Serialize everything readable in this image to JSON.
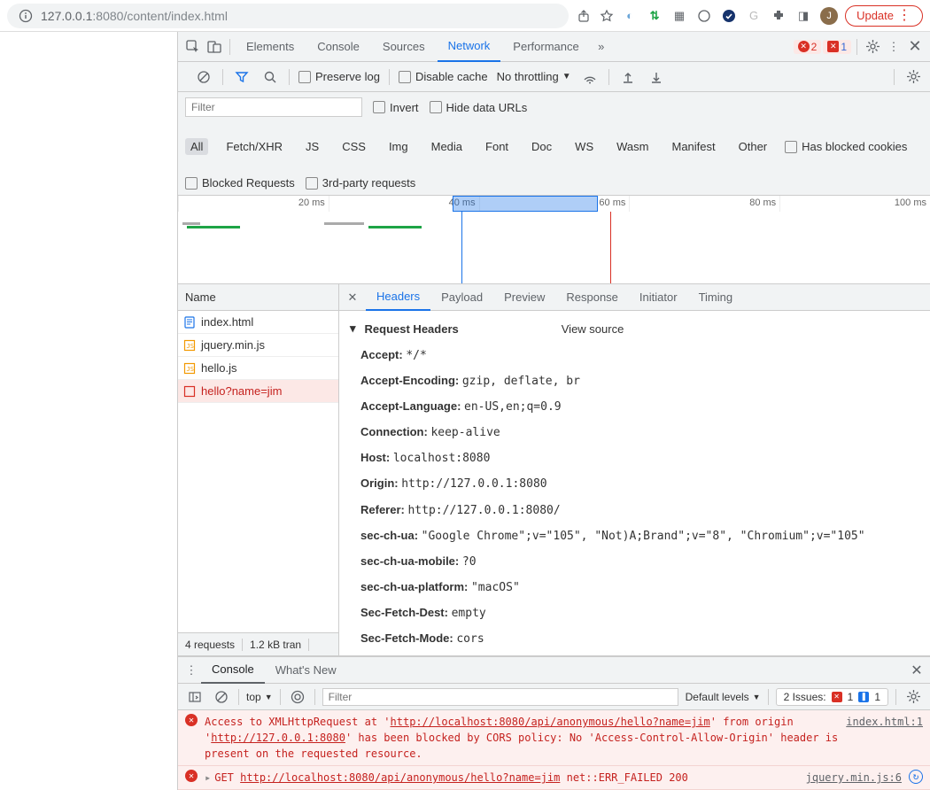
{
  "addressbar": {
    "url_host": "127.0.0.1",
    "url_port": ":8080",
    "url_path": "/content/index.html",
    "update_label": "Update",
    "avatar_initial": "J"
  },
  "devtools_tabs": {
    "elements": "Elements",
    "console": "Console",
    "sources": "Sources",
    "network": "Network",
    "performance": "Performance"
  },
  "badges": {
    "errors": "2",
    "issues": "1"
  },
  "net_toolbar": {
    "preserve_log": "Preserve log",
    "disable_cache": "Disable cache",
    "throttling": "No throttling"
  },
  "filter": {
    "placeholder": "Filter",
    "invert": "Invert",
    "hide_data_urls": "Hide data URLs",
    "types": [
      "All",
      "Fetch/XHR",
      "JS",
      "CSS",
      "Img",
      "Media",
      "Font",
      "Doc",
      "WS",
      "Wasm",
      "Manifest",
      "Other"
    ],
    "has_blocked": "Has blocked cookies",
    "blocked_requests": "Blocked Requests",
    "third_party": "3rd-party requests"
  },
  "timeline": {
    "ticks": [
      "20 ms",
      "40 ms",
      "60 ms",
      "80 ms",
      "100 ms"
    ]
  },
  "requests": {
    "header": "Name",
    "rows": [
      {
        "name": "index.html",
        "type": "doc",
        "color": "#1a73e8"
      },
      {
        "name": "jquery.min.js",
        "type": "js",
        "color": "#f29900"
      },
      {
        "name": "hello.js",
        "type": "js",
        "color": "#f29900"
      },
      {
        "name": "hello?name=jim",
        "type": "xhr",
        "color": "#d93025"
      }
    ],
    "footer": {
      "count": "4 requests",
      "size": "1.2 kB tran"
    }
  },
  "detail_tabs": [
    "Headers",
    "Payload",
    "Preview",
    "Response",
    "Initiator",
    "Timing"
  ],
  "headers_section": {
    "title": "Request Headers",
    "view_source": "View source",
    "items": [
      {
        "k": "Accept:",
        "v": "*/*"
      },
      {
        "k": "Accept-Encoding:",
        "v": "gzip, deflate, br"
      },
      {
        "k": "Accept-Language:",
        "v": "en-US,en;q=0.9"
      },
      {
        "k": "Connection:",
        "v": "keep-alive"
      },
      {
        "k": "Host:",
        "v": "localhost:8080"
      },
      {
        "k": "Origin:",
        "v": "http://127.0.0.1:8080"
      },
      {
        "k": "Referer:",
        "v": "http://127.0.0.1:8080/"
      },
      {
        "k": "sec-ch-ua:",
        "v": "\"Google Chrome\";v=\"105\", \"Not)A;Brand\";v=\"8\", \"Chromium\";v=\"105\""
      },
      {
        "k": "sec-ch-ua-mobile:",
        "v": "?0"
      },
      {
        "k": "sec-ch-ua-platform:",
        "v": "\"macOS\""
      },
      {
        "k": "Sec-Fetch-Dest:",
        "v": "empty"
      },
      {
        "k": "Sec-Fetch-Mode:",
        "v": "cors"
      }
    ]
  },
  "drawer": {
    "tabs": {
      "console": "Console",
      "whatsnew": "What's New"
    },
    "context": "top",
    "filter_placeholder": "Filter",
    "levels": "Default levels",
    "issues_label": "2 Issues:",
    "issues_err": "1",
    "issues_info": "1"
  },
  "console_msgs": {
    "cors_pre": "Access to XMLHttpRequest at '",
    "cors_url1": "http://localhost:8080/api/anonymous/hello?name=jim",
    "cors_mid": "' from origin '",
    "cors_url2": "http://127.0.0.1:8080",
    "cors_post": "' has been blocked by CORS policy: No 'Access-Control-Allow-Origin' header is present on the requested resource.",
    "cors_src": "index.html:1",
    "get_pre": "GET ",
    "get_url": "http://localhost:8080/api/anonymous/hello?name=jim",
    "get_err": " net::ERR_FAILED 200",
    "get_src": "jquery.min.js:6"
  }
}
